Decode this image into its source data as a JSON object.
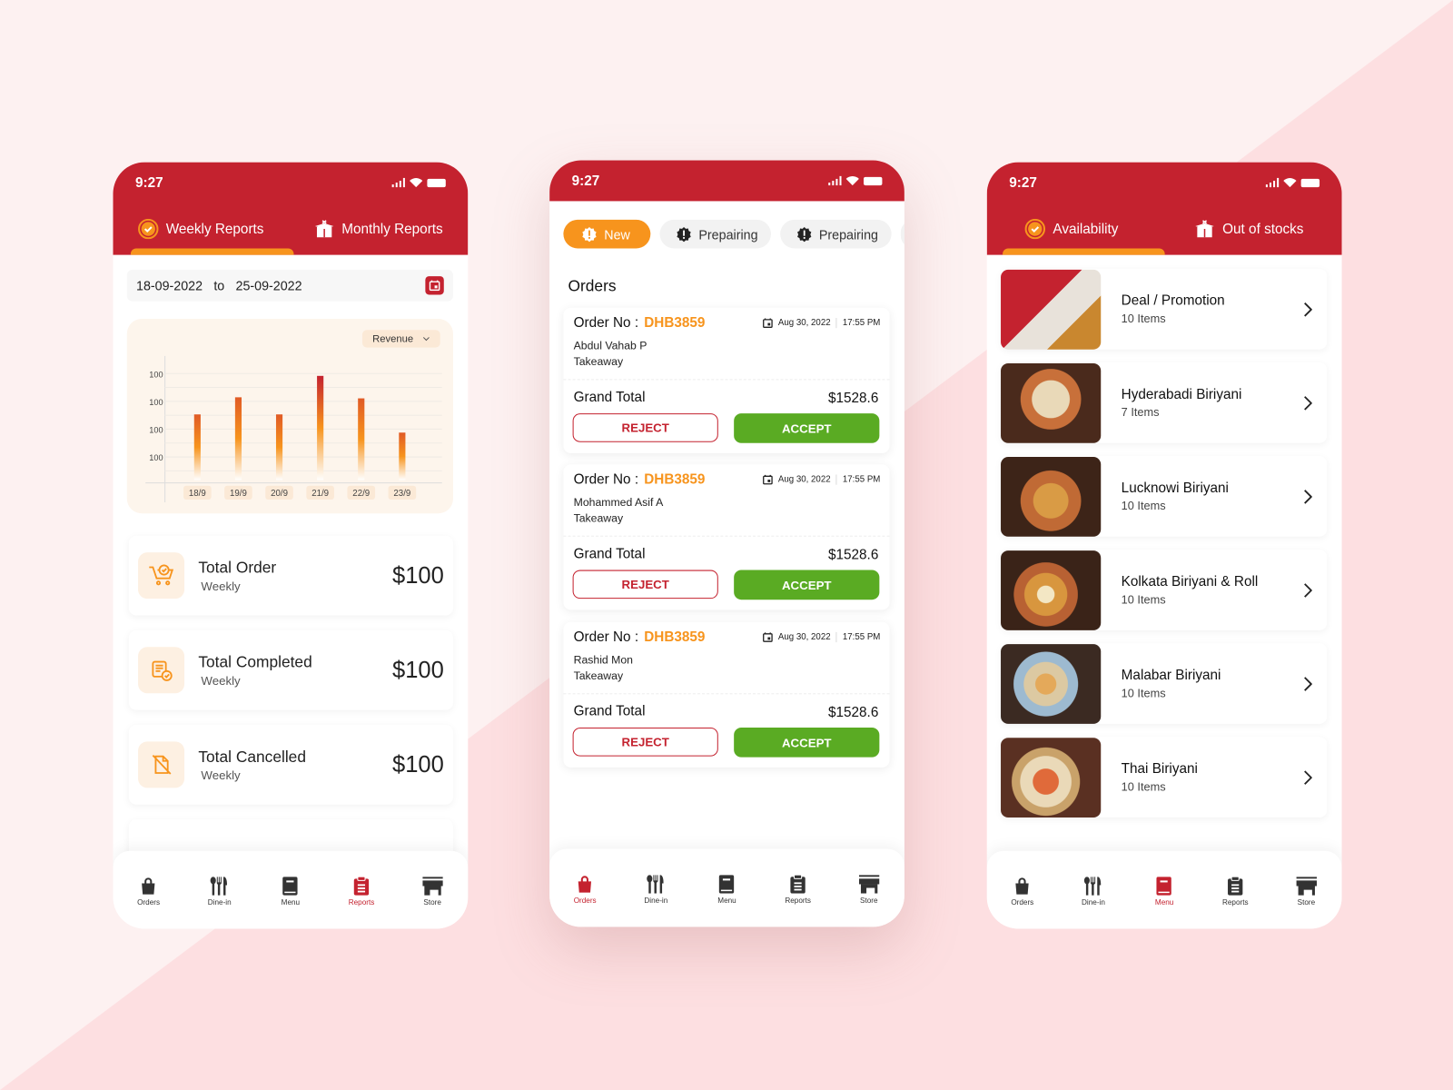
{
  "colors": {
    "brand_red": "#c4222f",
    "accent_orange": "#f7941d",
    "accept_green": "#5aab23"
  },
  "status_bar": {
    "time": "9:27"
  },
  "reports_screen": {
    "tabs": [
      {
        "label": "Weekly Reports",
        "icon": "check-badge-icon",
        "active": true
      },
      {
        "label": "Monthly Reports",
        "icon": "box-icon",
        "active": false
      }
    ],
    "date_range": {
      "from": "18-09-2022",
      "separator": "to",
      "to": "25-09-2022"
    },
    "chart_dropdown": "Revenue",
    "stats": [
      {
        "title": "Total Order",
        "period": "Weekly",
        "value": "$100",
        "icon": "cart-check-icon"
      },
      {
        "title": "Total Completed",
        "period": "Weekly",
        "value": "$100",
        "icon": "list-check-icon"
      },
      {
        "title": "Total Cancelled",
        "period": "Weekly",
        "value": "$100",
        "icon": "document-cancel-icon"
      }
    ]
  },
  "chart_data": {
    "type": "bar",
    "title": "",
    "xlabel": "",
    "ylabel": "Revenue",
    "categories": [
      "18/9",
      "19/9",
      "20/9",
      "21/9",
      "22/9",
      "23/9"
    ],
    "values": [
      64,
      80,
      64,
      100,
      79,
      47
    ],
    "y_tick_labels": [
      "100",
      "100",
      "100",
      "100"
    ],
    "ylim": [
      0,
      110
    ],
    "grid": true
  },
  "orders_screen": {
    "filters": [
      {
        "label": "New",
        "active": true
      },
      {
        "label": "Prepairing",
        "active": false
      },
      {
        "label": "Prepairing",
        "active": false
      }
    ],
    "section_title": "Orders",
    "order_no_label": "Order No :",
    "grand_total_label": "Grand Total",
    "reject_label": "REJECT",
    "accept_label": "ACCEPT",
    "orders": [
      {
        "id": "DHB3859",
        "date": "Aug 30, 2022",
        "time": "17:55 PM",
        "customer": "Abdul Vahab P",
        "type": "Takeaway",
        "total": "$1528.6"
      },
      {
        "id": "DHB3859",
        "date": "Aug 30, 2022",
        "time": "17:55 PM",
        "customer": "Mohammed Asif A",
        "type": "Takeaway",
        "total": "$1528.6"
      },
      {
        "id": "DHB3859",
        "date": "Aug 30, 2022",
        "time": "17:55 PM",
        "customer": "Rashid Mon",
        "type": "Takeaway",
        "total": "$1528.6"
      }
    ]
  },
  "menu_screen": {
    "tabs": [
      {
        "label": "Availability",
        "icon": "check-badge-icon",
        "active": true
      },
      {
        "label": "Out of stocks",
        "icon": "box-icon",
        "active": false
      }
    ],
    "categories": [
      {
        "name": "Deal / Promotion",
        "count": "10 Items"
      },
      {
        "name": "Hyderabadi Biriyani",
        "count": "7 Items"
      },
      {
        "name": "Lucknowi Biriyani",
        "count": "10 Items"
      },
      {
        "name": "Kolkata Biriyani & Roll",
        "count": "10 Items"
      },
      {
        "name": "Malabar Biriyani",
        "count": "10 Items"
      },
      {
        "name": "Thai Biriyani",
        "count": "10 Items"
      }
    ]
  },
  "bottom_nav": {
    "items": [
      {
        "label": "Orders",
        "icon": "shopping-bag-icon"
      },
      {
        "label": "Dine-in",
        "icon": "utensils-icon"
      },
      {
        "label": "Menu",
        "icon": "book-icon"
      },
      {
        "label": "Reports",
        "icon": "clipboard-icon"
      },
      {
        "label": "Store",
        "icon": "store-icon"
      }
    ]
  }
}
